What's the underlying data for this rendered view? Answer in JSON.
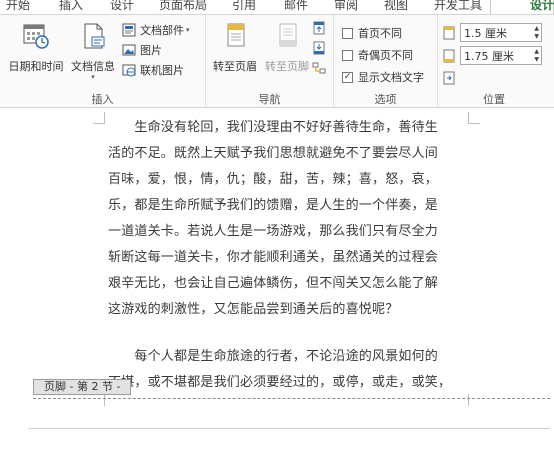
{
  "tabs": [
    "开始",
    "插入",
    "设计",
    "页面布局",
    "引用",
    "邮件",
    "审阅",
    "视图",
    "开发工具",
    "设计"
  ],
  "insert_group": {
    "label": "插入",
    "datetime_label": "日期和时间",
    "docinfo_label": "文档信息",
    "docparts_label": "文档部件",
    "picture_label": "图片",
    "online_picture_label": "联机图片"
  },
  "nav_group": {
    "label": "导航",
    "goto_header_label": "转至页眉",
    "goto_footer_label": "转至页脚"
  },
  "options_group": {
    "label": "选项",
    "first_page_diff": {
      "label": "首页不同",
      "checked": false
    },
    "odd_even_diff": {
      "label": "奇偶页不同",
      "checked": false
    },
    "show_doc_text": {
      "label": "显示文档文字",
      "checked": true
    }
  },
  "position_group": {
    "label": "位置",
    "header_top": "1.5 厘米",
    "footer_bottom": "1.75 厘米"
  },
  "document": {
    "paragraph1": [
      "　　生命没有轮回，我们没理由不好好善待生命，善待生",
      "活的不足。既然上天赋予我们思想就避免不了要尝尽人间",
      "百味，爱，恨，情，仇；酸，甜，苦，辣；喜，怒，哀，",
      "乐，都是生命所赋予我们的馈赠，是人生的一个伴奏，是",
      "一道道关卡。若说人生是一场游戏，那么我们只有尽全力",
      "斩断这每一道关卡，你才能顺利通关，虽然通关的过程会",
      "艰辛无比，也会让自己遍体鳞伤，但不闯关又怎么能了解",
      "这游戏的刺激性，又怎能品尝到通关后的喜悦呢？"
    ],
    "paragraph2": [
      "　　每个人都是生命旅途的行者，不论沿途的风景如何的",
      "不堪，或不堪都是我们必须要经过的，或停，或走，或笑，"
    ],
    "footer_tag": "页脚 - 第 2 节 -"
  }
}
